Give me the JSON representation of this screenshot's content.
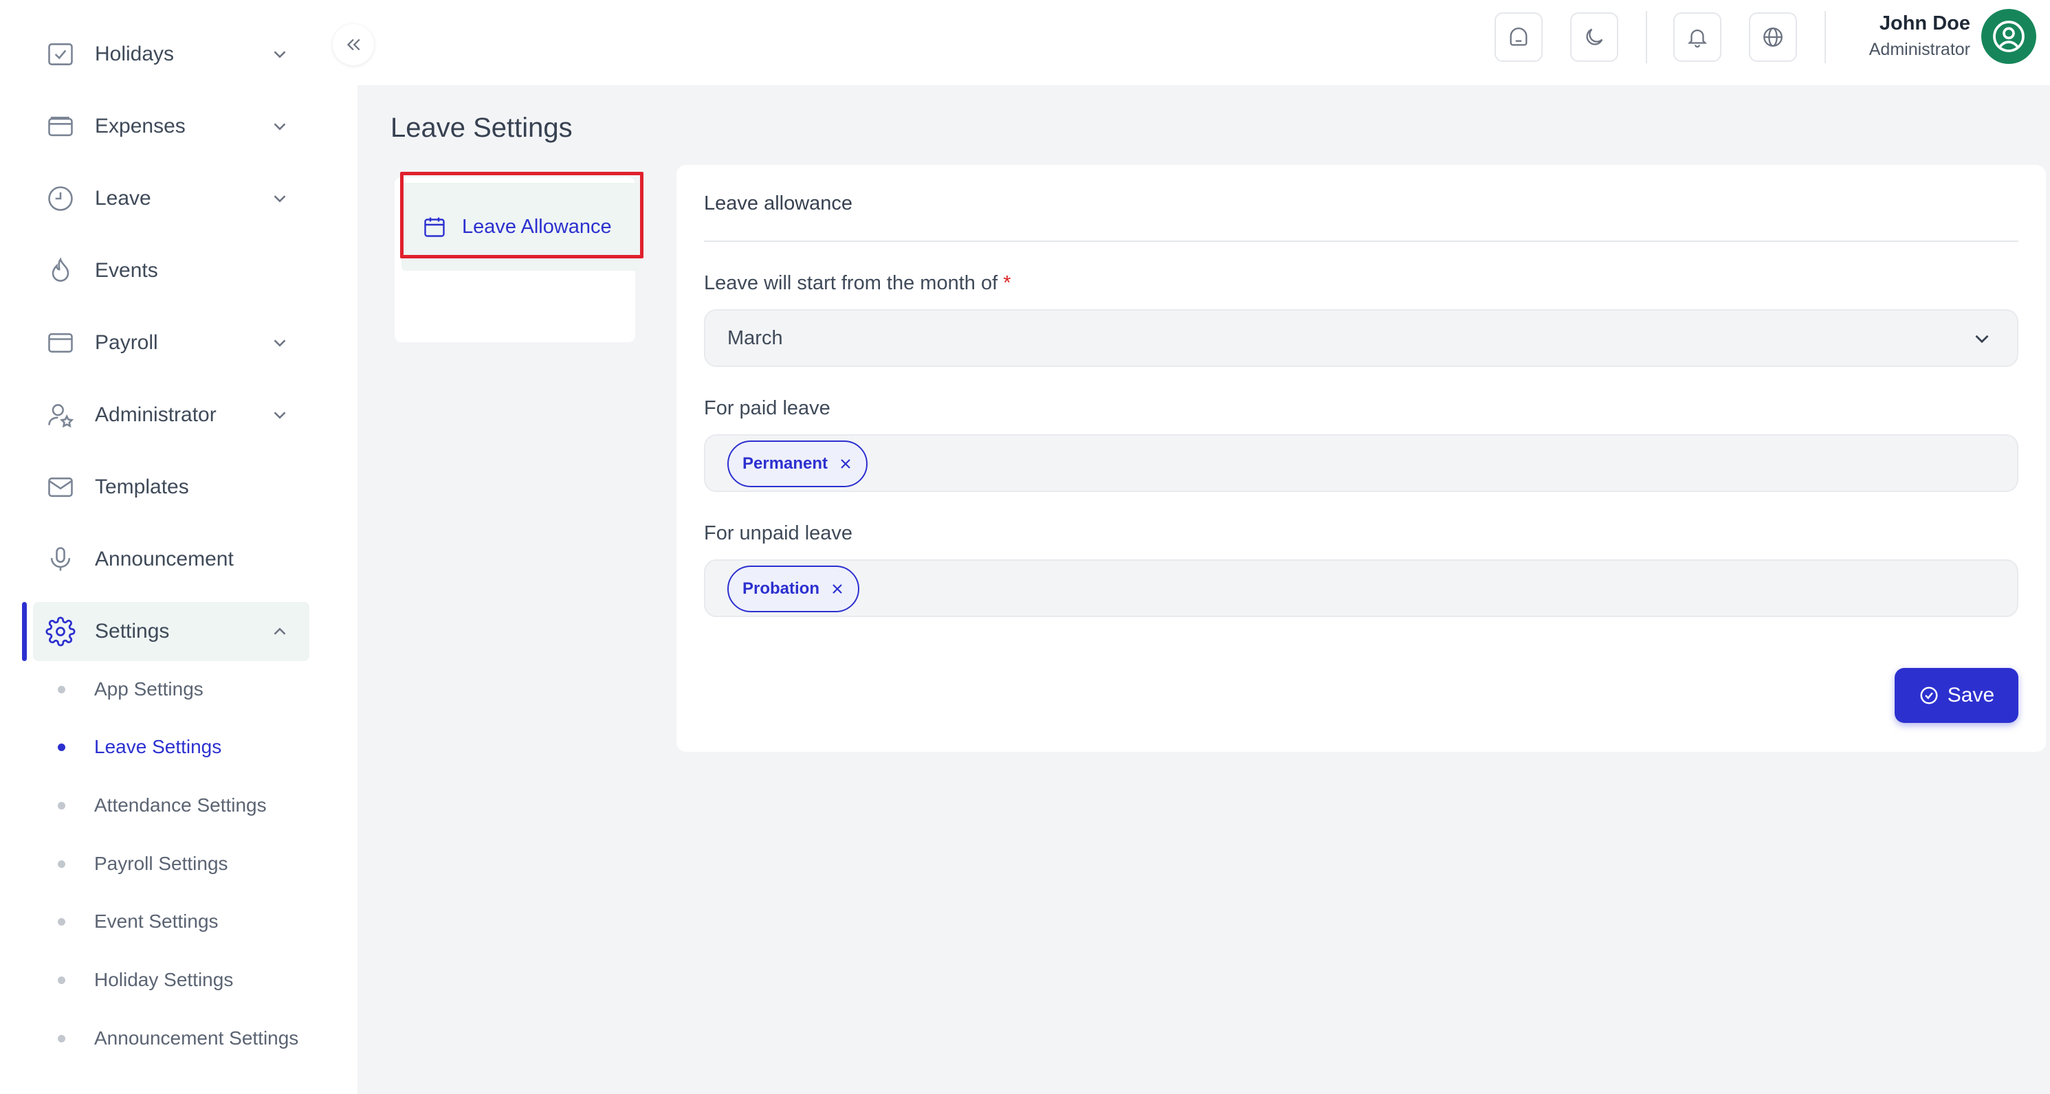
{
  "sidebar": {
    "items": [
      {
        "label": "Holidays",
        "icon": "calendar-check-icon",
        "has_chevron": true
      },
      {
        "label": "Expenses",
        "icon": "wallet-icon",
        "has_chevron": true
      },
      {
        "label": "Leave",
        "icon": "clock-icon",
        "has_chevron": true
      },
      {
        "label": "Events",
        "icon": "flame-icon",
        "has_chevron": false
      },
      {
        "label": "Payroll",
        "icon": "credit-card-icon",
        "has_chevron": true
      },
      {
        "label": "Administrator",
        "icon": "user-star-icon",
        "has_chevron": true
      },
      {
        "label": "Templates",
        "icon": "mail-icon",
        "has_chevron": false
      },
      {
        "label": "Announcement",
        "icon": "microphone-icon",
        "has_chevron": false
      },
      {
        "label": "Settings",
        "icon": "gear-icon",
        "has_chevron": true,
        "expanded": true,
        "active": true
      }
    ],
    "settings_sub": [
      {
        "label": "App Settings"
      },
      {
        "label": "Leave Settings",
        "active": true
      },
      {
        "label": "Attendance Settings"
      },
      {
        "label": "Payroll Settings"
      },
      {
        "label": "Event Settings"
      },
      {
        "label": "Holiday Settings"
      },
      {
        "label": "Announcement Settings"
      }
    ]
  },
  "topbar": {
    "user_name": "John Doe",
    "user_role": "Administrator"
  },
  "page": {
    "title": "Leave Settings",
    "tab_label": "Leave Allowance"
  },
  "card": {
    "title": "Leave allowance",
    "start_month_label": "Leave will start from the month of",
    "required_mark": "*",
    "start_month_value": "March",
    "paid_label": "For paid leave",
    "paid_tags": [
      "Permanent"
    ],
    "unpaid_label": "For unpaid leave",
    "unpaid_tags": [
      "Probation"
    ],
    "save_label": "Save"
  },
  "colors": {
    "accent": "#2c30cf",
    "avatar_bg": "#16865a",
    "highlight": "#e0202d",
    "main_bg": "#f3f4f6"
  }
}
